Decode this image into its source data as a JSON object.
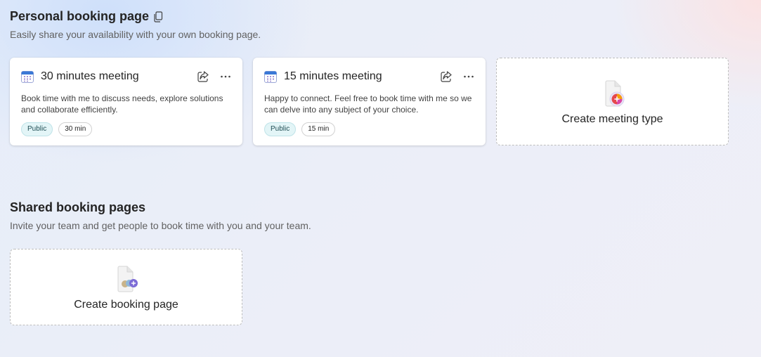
{
  "personal": {
    "title": "Personal booking page",
    "subtitle": "Easily share your availability with your own booking page.",
    "copy_icon": "copy-icon",
    "meetings": [
      {
        "title": "30 minutes meeting",
        "description": "Book time with me to discuss needs, explore solutions and collaborate efficiently.",
        "visibility": "Public",
        "duration": "30 min",
        "icon": "calendar-icon"
      },
      {
        "title": "15 minutes meeting",
        "description": "Happy to connect. Feel free to book time with me so we can delve into any subject of your choice.",
        "visibility": "Public",
        "duration": "15 min",
        "icon": "calendar-icon"
      }
    ],
    "create_label": "Create meeting type"
  },
  "shared": {
    "title": "Shared booking pages",
    "subtitle": "Invite your team and get people to book time with you and your team.",
    "create_label": "Create booking page"
  },
  "colors": {
    "accent": "#0f6cbd",
    "public_tag_bg": "#e3f5f7",
    "text_primary": "#242424",
    "text_secondary": "#616161"
  }
}
